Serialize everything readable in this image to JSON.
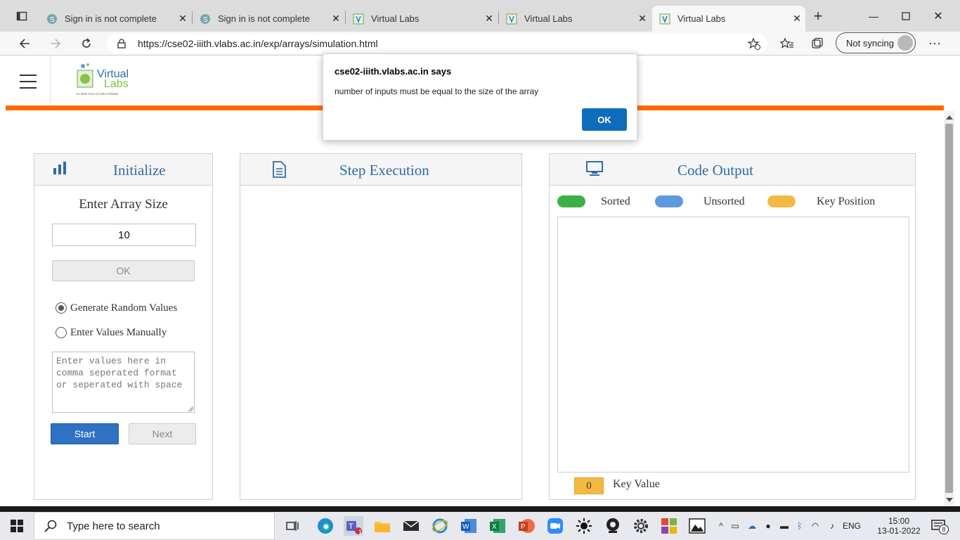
{
  "browser": {
    "tabs": [
      {
        "label": "Sign in is not complete",
        "active": false
      },
      {
        "label": "Sign in is not complete",
        "active": false
      },
      {
        "label": "Virtual Labs",
        "active": false
      },
      {
        "label": "Virtual Labs",
        "active": false
      },
      {
        "label": "Virtual Labs",
        "active": true
      }
    ],
    "url": "https://cse02-iiith.vlabs.ac.in/exp/arrays/simulation.html",
    "sync_label": "Not syncing"
  },
  "site": {
    "logo_text_top": "Virtual",
    "logo_text_bottom": "Labs",
    "logo_tagline": "An MoE Govt of India Initiative"
  },
  "initialize": {
    "title": "Initialize",
    "size_label": "Enter Array Size",
    "size_value": "10",
    "ok_label": "OK",
    "radio_random": "Generate Random Values",
    "radio_manual": "Enter Values Manually",
    "selected_option": "random",
    "values_placeholder": "Enter values here in comma seperated format or seperated with space",
    "start_label": "Start",
    "next_label": "Next"
  },
  "step_execution": {
    "title": "Step Execution"
  },
  "code_output": {
    "title": "Code Output",
    "legend": [
      {
        "label": "Sorted",
        "color": "#3cb044"
      },
      {
        "label": "Unsorted",
        "color": "#5b9bde"
      },
      {
        "label": "Key Position",
        "color": "#f5b942"
      }
    ],
    "key_value": "0",
    "key_value_label": "Key Value"
  },
  "dialog": {
    "title": "cse02-iiith.vlabs.ac.in says",
    "message": "number of inputs must be equal to the size of the array",
    "ok_label": "OK"
  },
  "taskbar": {
    "search_placeholder": "Type here to search",
    "language": "ENG",
    "time": "15:00",
    "date": "13-01-2022",
    "notification_count": "8",
    "teams_badge": "1"
  },
  "colors": {
    "accent_orange": "#ff6a00",
    "title_blue": "#2e6da4",
    "start_button": "#2f72c4",
    "dialog_ok": "#0f6cbd"
  }
}
